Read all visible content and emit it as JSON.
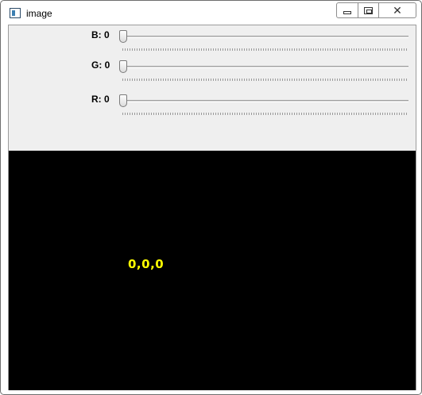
{
  "window": {
    "title": "image"
  },
  "trackbars": [
    {
      "label": "B: 0",
      "channel": "B",
      "value": 0,
      "min": 0,
      "max": 255
    },
    {
      "label": "G: 0",
      "channel": "G",
      "value": 0,
      "min": 0,
      "max": 255
    },
    {
      "label": "R: 0",
      "channel": "R",
      "value": 0,
      "min": 0,
      "max": 255
    }
  ],
  "canvas": {
    "text": "0,0,0",
    "background": "#000000",
    "text_color": "#ffff00"
  }
}
